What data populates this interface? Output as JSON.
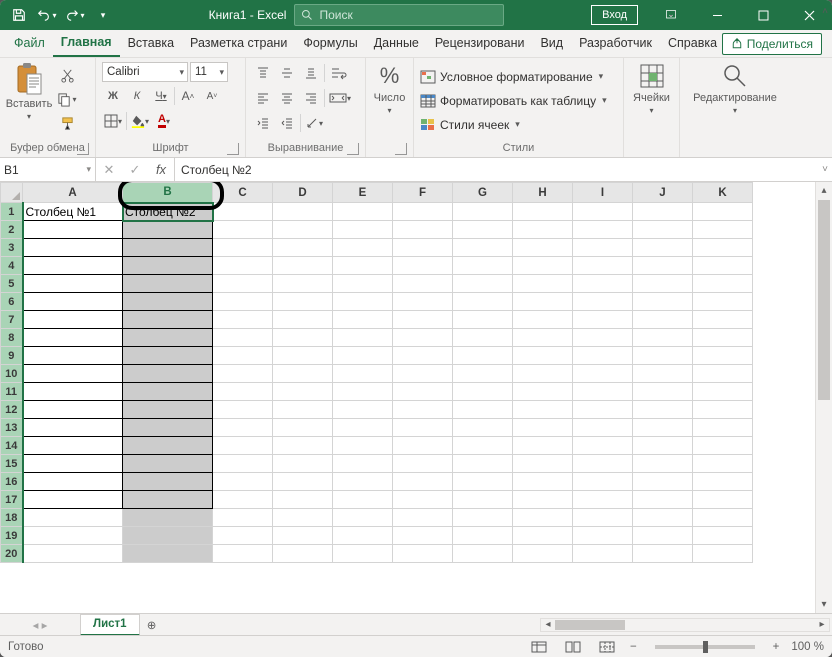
{
  "title": "Книга1  -  Excel",
  "search_placeholder": "Поиск",
  "login": "Вход",
  "tabs": {
    "file": "Файл",
    "home": "Главная",
    "insert": "Вставка",
    "layout": "Разметка страни",
    "formulas": "Формулы",
    "data": "Данные",
    "review": "Рецензировани",
    "view": "Вид",
    "developer": "Разработчик",
    "help": "Справка"
  },
  "share": "Поделиться",
  "ribbon": {
    "clipboard": {
      "paste": "Вставить",
      "label": "Буфер обмена"
    },
    "font": {
      "name": "Calibri",
      "size": "11",
      "bold": "Ж",
      "italic": "К",
      "underline": "Ч",
      "label": "Шрифт"
    },
    "align": {
      "label": "Выравнивание"
    },
    "number": {
      "big": "%",
      "label": "Число"
    },
    "styles": {
      "cond_fmt": "Условное форматирование",
      "as_table": "Форматировать как таблицу",
      "cell_styles": "Стили ячеек",
      "label": "Стили"
    },
    "cells": {
      "label": "Ячейки"
    },
    "editing": {
      "label": "Редактирование"
    }
  },
  "name_box": "B1",
  "formula": "Столбец №2",
  "columns": [
    "A",
    "B",
    "C",
    "D",
    "E",
    "F",
    "G",
    "H",
    "I",
    "J",
    "K"
  ],
  "rows": [
    "1",
    "2",
    "3",
    "4",
    "5",
    "6",
    "7",
    "8",
    "9",
    "10",
    "11",
    "12",
    "13",
    "14",
    "15",
    "16",
    "17",
    "18",
    "19",
    "20"
  ],
  "cells": {
    "A1": "Столбец №1",
    "B1": "Столбец №2"
  },
  "boxed_range": {
    "cols": [
      "A",
      "B"
    ],
    "rows_to": 17
  },
  "selected_column": "B",
  "sheet": {
    "name": "Лист1"
  },
  "status": {
    "ready": "Готово",
    "zoom": "100 %"
  }
}
